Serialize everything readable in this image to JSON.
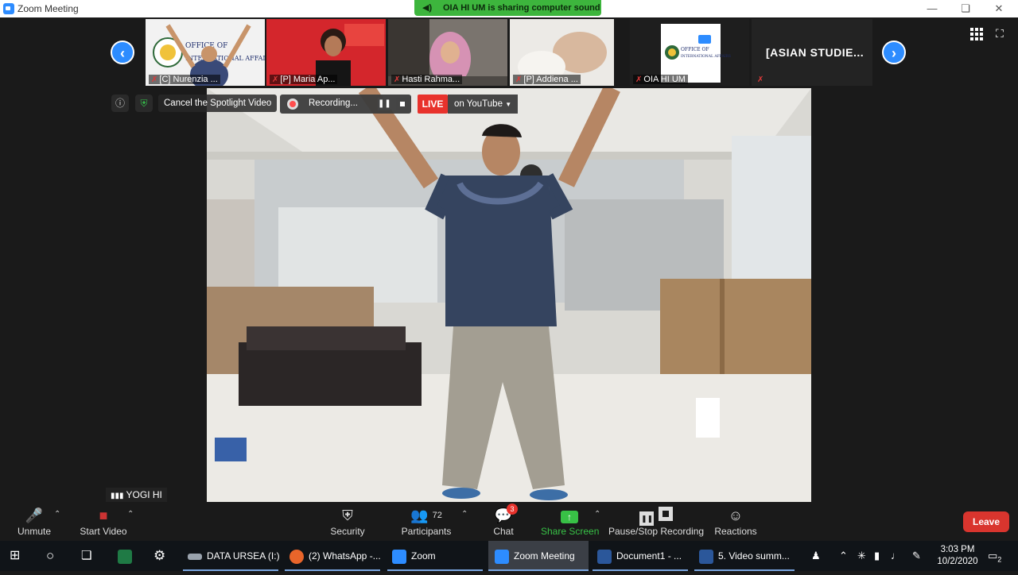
{
  "window": {
    "title": "Zoom Meeting"
  },
  "banner": {
    "text": "OIA HI UM is sharing computer sound"
  },
  "strip": {
    "participants": [
      {
        "label": "[C] Nurenzia ...",
        "logo_text_1": "OFFICE OF",
        "logo_text_2": "INTERNATIONAL AFFAIRS"
      },
      {
        "label": "[P] Maria Ap..."
      },
      {
        "label": "Hasti Rahma..."
      },
      {
        "label": "[P] Addiena ..."
      },
      {
        "label": "OIA HI UM",
        "logo_text_1": "OFFICE OF",
        "logo_text_2": "INTERNATIONAL AFFAIRS"
      },
      {
        "label": "[ASIAN STUDIE..."
      }
    ]
  },
  "overlay": {
    "spotlight_label": "Cancel the Spotlight Video",
    "recording_label": "Recording...",
    "live_label": "LIVE",
    "youtube_label": "on YouTube"
  },
  "speaker": {
    "name": "YOGI HI"
  },
  "toolbar": {
    "unmute": "Unmute",
    "start_video": "Start Video",
    "security": "Security",
    "participants": "Participants",
    "participants_count": "72",
    "chat": "Chat",
    "chat_badge": "3",
    "share_screen": "Share Screen",
    "pause_stop": "Pause/Stop Recording",
    "reactions": "Reactions",
    "leave": "Leave"
  },
  "taskbar": {
    "items": [
      {
        "label": "DATA URSEA (I:)"
      },
      {
        "label": "(2) WhatsApp -..."
      },
      {
        "label": "Zoom"
      },
      {
        "label": "Zoom Meeting"
      },
      {
        "label": "Document1 - ..."
      },
      {
        "label": "5. Video summ..."
      }
    ],
    "time": "3:03 PM",
    "date": "10/2/2020",
    "notifications": "2"
  }
}
